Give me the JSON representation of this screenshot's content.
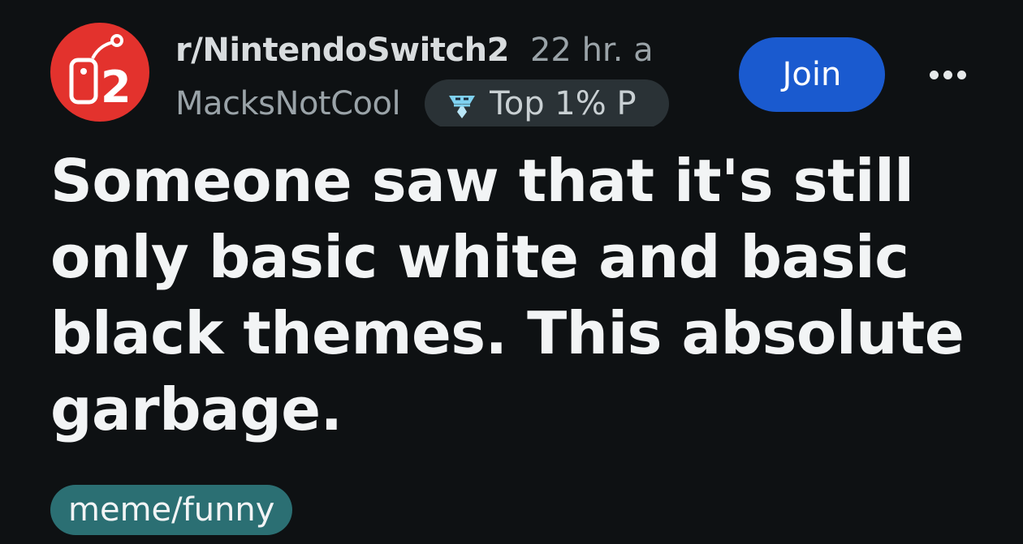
{
  "post_header": {
    "subreddit": "r/NintendoSwitch2",
    "separator": "·",
    "time": "22 hr. a",
    "author": "MacksNotCool",
    "flair": "Top 1% P"
  },
  "buttons": {
    "join_label": "Join",
    "more_icon": "more-horizontal-icon"
  },
  "post": {
    "title": "Someone saw that it's still only basic white and basic black themes. This absolute garbage.",
    "flair": "meme/funny"
  },
  "avatar": {
    "text": "2",
    "background": "#e3322d"
  },
  "colors": {
    "background": "#0e1113",
    "join_button": "#1a5acf",
    "post_flair": "#2b6f73",
    "user_flair": "#2a3236"
  }
}
